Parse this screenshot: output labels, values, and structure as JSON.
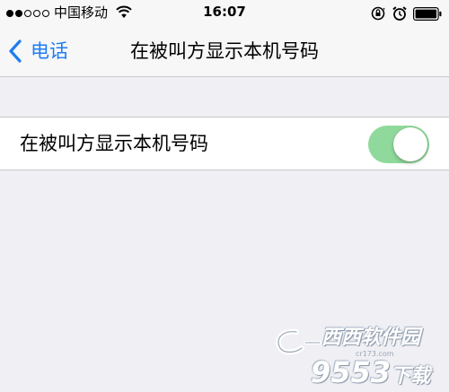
{
  "status_bar": {
    "carrier": "中国移动",
    "time": "16:07",
    "signal_bars_filled": 2,
    "signal_bars_total": 5
  },
  "nav": {
    "back_label": "电话",
    "title": "在被叫方显示本机号码"
  },
  "settings": {
    "row_label": "在被叫方显示本机号码",
    "toggle_on": true
  },
  "watermark": {
    "top": "西西软件园",
    "url": "cr173.com",
    "bottom_digits": "9553",
    "bottom_suffix": "下载"
  },
  "colors": {
    "accent": "#1f7cf1",
    "toggle_on": "#90d99c",
    "background": "#efeff4"
  }
}
